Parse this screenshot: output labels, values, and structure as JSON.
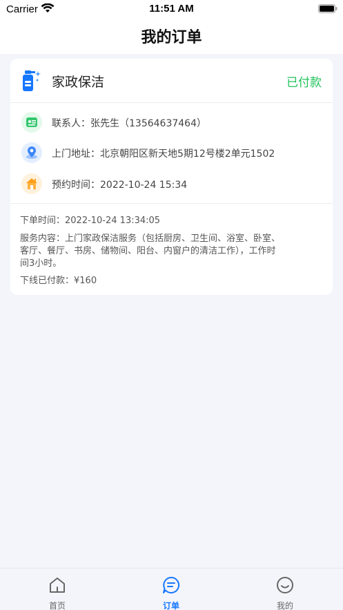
{
  "status_bar": {
    "carrier": "Carrier",
    "time": "11:51 AM"
  },
  "nav": {
    "title": "我的订单"
  },
  "order": {
    "service_name": "家政保洁",
    "status": "已付款",
    "status_color": "#22c25a",
    "contact": "联系人：张先生（13564637464）",
    "address": "上门地址：北京朝阳区新天地5期12号楼2单元1502",
    "appointment": "预约时间：2022-10-24 15:34",
    "order_time": "下单时间：2022-10-24 13:34:05",
    "content_line1": "服务内容：上门家政保洁服务（包括厨房、卫生间、浴室、卧室、",
    "content_line2": "客厅、餐厅、书房、储物间、阳台、内窗户的清洁工作），工作时",
    "content_line3": "间3小时。",
    "payment": "下线已付款：¥160",
    "icons": [
      "cleaning-spray-icon",
      "contact-card-icon",
      "location-pin-icon",
      "house-icon"
    ]
  },
  "tab_bar": {
    "accent_color": "#1677ff",
    "inactive_color": "#666666",
    "tabs": [
      {
        "label": "首页",
        "icon": "home-icon",
        "active": false
      },
      {
        "label": "订单",
        "icon": "order-chat-icon",
        "active": true
      },
      {
        "label": "我的",
        "icon": "smile-icon",
        "active": false
      }
    ]
  }
}
